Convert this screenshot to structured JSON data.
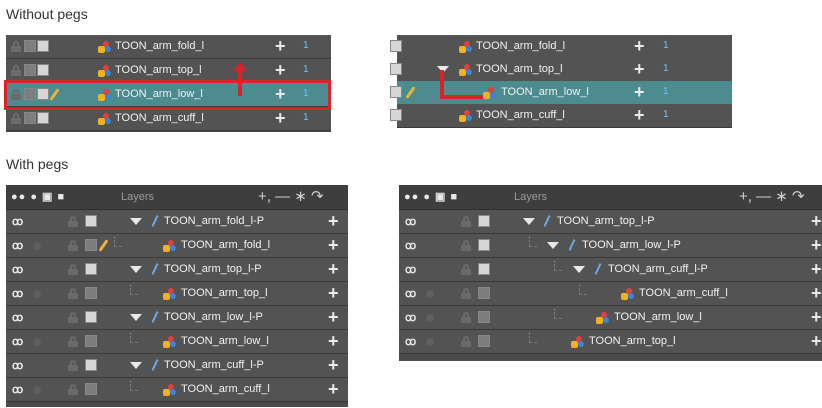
{
  "sections": {
    "without_pegs": "Without pegs",
    "with_pegs": "With pegs"
  },
  "number_value": "1",
  "layers_header": "Layers",
  "toolbar_icons": "●● ● ▣ ■",
  "tb_right": "+, — ∗ ↷",
  "without_left": [
    {
      "label": "TOON_arm_fold_l"
    },
    {
      "label": "TOON_arm_top_l"
    },
    {
      "label": "TOON_arm_low_l"
    },
    {
      "label": "TOON_arm_cuff_l"
    }
  ],
  "without_right": [
    {
      "label": "TOON_arm_fold_l"
    },
    {
      "label": "TOON_arm_top_l"
    },
    {
      "label": "TOON_arm_low_l"
    },
    {
      "label": "TOON_arm_cuff_l"
    }
  ],
  "with_left": [
    {
      "label": "TOON_arm_fold_l-P"
    },
    {
      "label": "TOON_arm_fold_l"
    },
    {
      "label": "TOON_arm_top_l-P"
    },
    {
      "label": "TOON_arm_top_l"
    },
    {
      "label": "TOON_arm_low_l-P"
    },
    {
      "label": "TOON_arm_low_l"
    },
    {
      "label": "TOON_arm_cuff_l-P"
    },
    {
      "label": "TOON_arm_cuff_l"
    }
  ],
  "with_right": [
    {
      "label": "TOON_arm_top_l-P"
    },
    {
      "label": "TOON_arm_low_l-P"
    },
    {
      "label": "TOON_arm_cuff_l-P"
    },
    {
      "label": "TOON_arm_cuff_l"
    },
    {
      "label": "TOON_arm_low_l"
    },
    {
      "label": "TOON_arm_top_l"
    }
  ],
  "colors": {
    "row": "#535353",
    "selected": "#4c8b8e",
    "highlight_box": "#d9222a",
    "number": "#6cc6ff"
  }
}
